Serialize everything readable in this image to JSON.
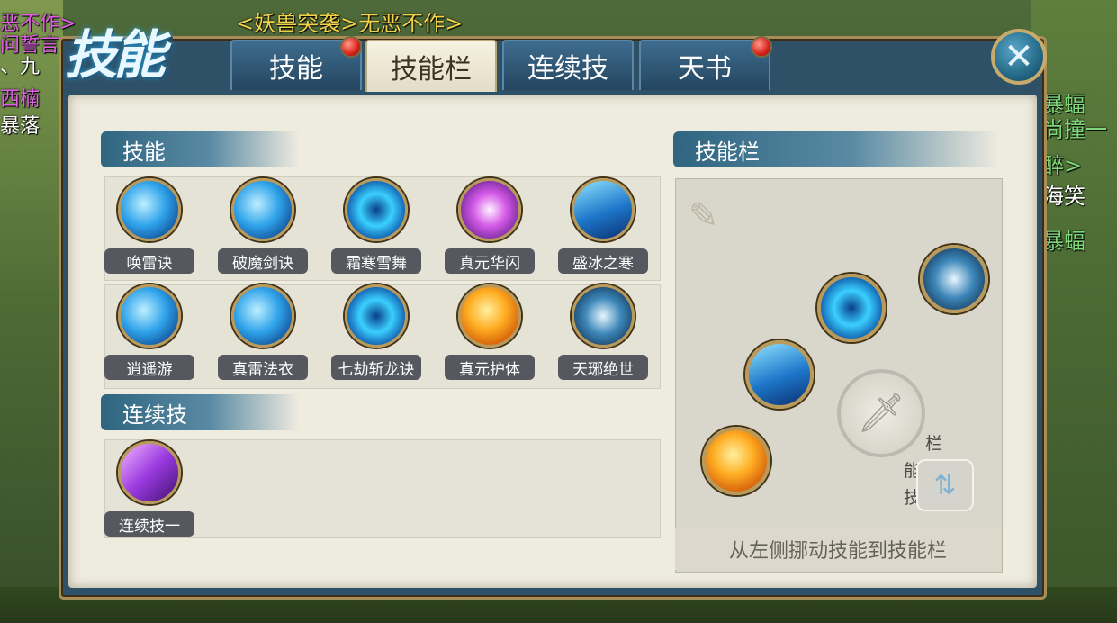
{
  "world": {
    "event_banner": "<妖兽突袭>无恶不作>",
    "left_names": [
      "恶不作>",
      "问誓言",
      "、九",
      "西楠",
      "暴落"
    ],
    "right_names": [
      "暴蝠",
      "尚撞一",
      "醉>",
      "海笑",
      "暴蝠"
    ]
  },
  "panel": {
    "title": "技能",
    "tabs": [
      {
        "label": "技能",
        "badge": true
      },
      {
        "label": "技能栏",
        "badge": false,
        "active": true
      },
      {
        "label": "连续技",
        "badge": false
      },
      {
        "label": "天书",
        "badge": true
      }
    ],
    "close_icon": "close-icon"
  },
  "skills_section": {
    "title": "技能",
    "row1": [
      "唤雷诀",
      "破魔剑诀",
      "霜寒雪舞",
      "真元华闪",
      "盛冰之寒"
    ],
    "row2": [
      "逍遥游",
      "真雷法衣",
      "七劫斩龙诀",
      "真元护体",
      "天琊绝世"
    ]
  },
  "combo_section": {
    "title": "连续技",
    "items": [
      "连续技一"
    ]
  },
  "skill_bar_section": {
    "title": "技能栏",
    "switch_label": "技能栏一",
    "hint": "从左侧挪动技能到技能栏",
    "slots": [
      "天琊绝世",
      "七劫斩龙诀",
      "盛冰之寒",
      "真元护体"
    ]
  }
}
